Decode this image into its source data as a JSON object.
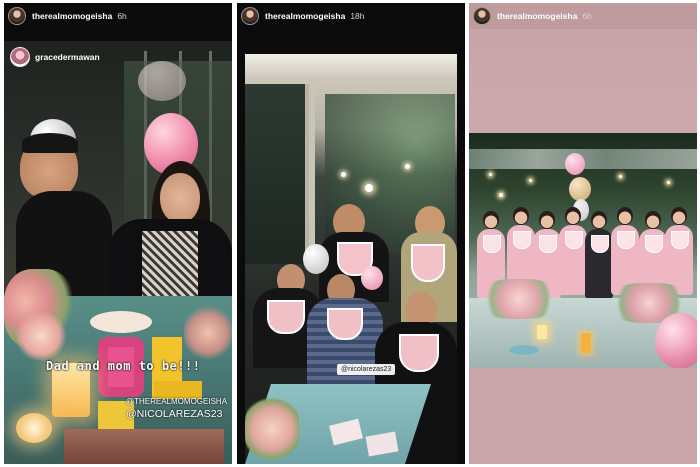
{
  "stories": [
    {
      "username": "therealmomogeisha",
      "time": "6h",
      "repost_username": "gracedermawan",
      "caption": "Dad and mom to be!!!",
      "mention1": "@THEREALMOMOGEISHA",
      "mention2": "@NICOLAREZAS23"
    },
    {
      "username": "therealmomogeisha",
      "time": "18h",
      "mention": "@nicolarezas23"
    },
    {
      "username": "therealmomogeisha",
      "time": "6h"
    }
  ],
  "colors": {
    "story_bg": "#0b0b0b",
    "pink_panel": "#c8a5a8",
    "text": "#ffffff"
  }
}
